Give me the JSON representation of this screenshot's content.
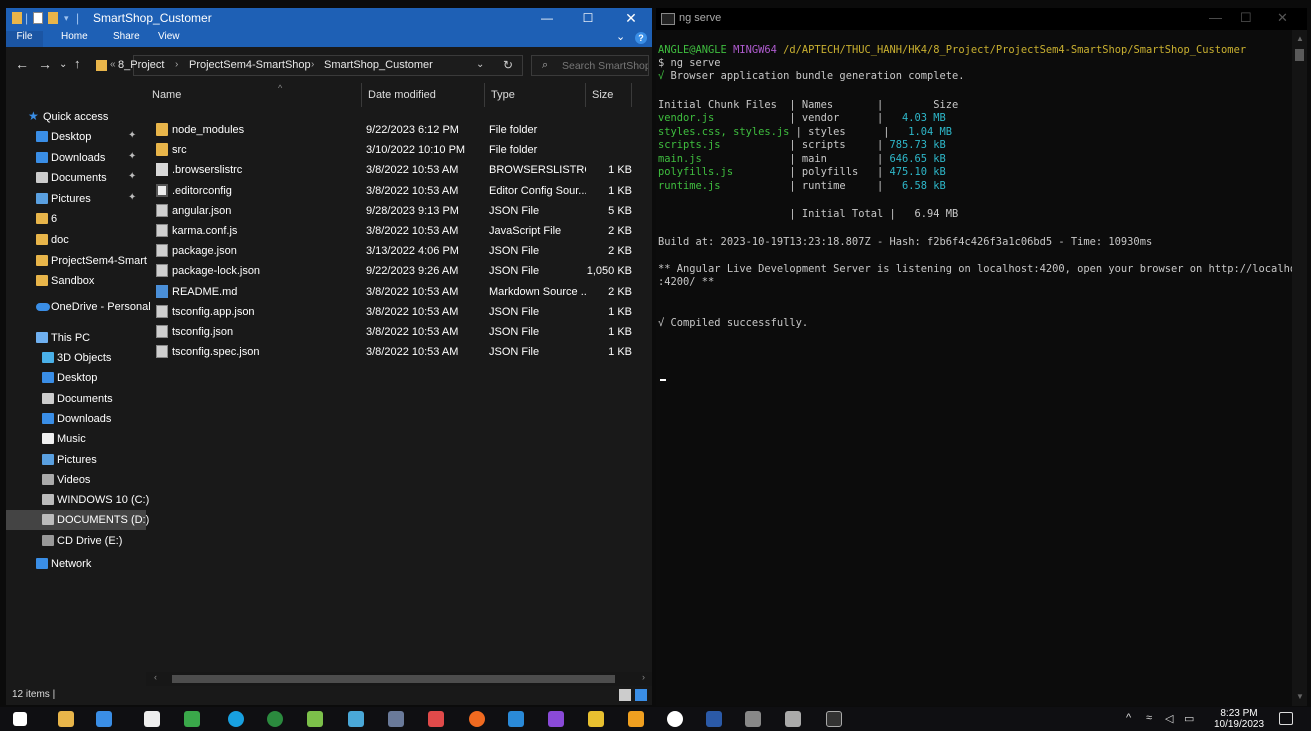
{
  "explorer": {
    "title": "SmartShop_Customer",
    "ribbon": {
      "file": "File",
      "home": "Home",
      "share": "Share",
      "view": "View"
    },
    "breadcrumb": [
      "8_Project",
      "ProjectSem4-SmartShop",
      "SmartShop_Customer"
    ],
    "search_placeholder": "Search SmartShop...",
    "columns": {
      "name": "Name",
      "date": "Date modified",
      "type": "Type",
      "size": "Size"
    },
    "quick_access_label": "Quick access",
    "nav": [
      {
        "label": "Desktop",
        "icon": "desktop-icon",
        "pinned": true
      },
      {
        "label": "Downloads",
        "icon": "download-icon",
        "pinned": true
      },
      {
        "label": "Documents",
        "icon": "documents-icon",
        "pinned": true
      },
      {
        "label": "Pictures",
        "icon": "pictures-icon",
        "pinned": true
      },
      {
        "label": "6",
        "icon": "folder-icon",
        "pinned": false
      },
      {
        "label": "doc",
        "icon": "folder-icon",
        "pinned": false
      },
      {
        "label": "ProjectSem4-Smart",
        "icon": "folder-icon",
        "pinned": false
      },
      {
        "label": "Sandbox",
        "icon": "folder-icon",
        "pinned": false
      }
    ],
    "onedrive_label": "OneDrive - Personal",
    "thispc_label": "This PC",
    "pc_items": [
      {
        "label": "3D Objects",
        "icon": "3d-objects-icon"
      },
      {
        "label": "Desktop",
        "icon": "desktop-icon"
      },
      {
        "label": "Documents",
        "icon": "documents-icon"
      },
      {
        "label": "Downloads",
        "icon": "download-icon"
      },
      {
        "label": "Music",
        "icon": "music-icon"
      },
      {
        "label": "Pictures",
        "icon": "pictures-icon"
      },
      {
        "label": "Videos",
        "icon": "videos-icon"
      },
      {
        "label": "WINDOWS 10 (C:)",
        "icon": "drive-icon"
      },
      {
        "label": "DOCUMENTS (D:)",
        "icon": "drive-icon"
      },
      {
        "label": "CD Drive (E:)",
        "icon": "cd-drive-icon"
      }
    ],
    "network_label": "Network",
    "files": [
      {
        "name": "node_modules",
        "date": "9/22/2023 6:12 PM",
        "type": "File folder",
        "size": "",
        "icon": "folder"
      },
      {
        "name": "src",
        "date": "3/10/2022 10:10 PM",
        "type": "File folder",
        "size": "",
        "icon": "folder"
      },
      {
        "name": ".browserslistrc",
        "date": "3/8/2022 10:53 AM",
        "type": "BROWSERSLISTRC...",
        "size": "1 KB",
        "icon": "doc"
      },
      {
        "name": ".editorconfig",
        "date": "3/8/2022 10:53 AM",
        "type": "Editor Config Sour...",
        "size": "1 KB",
        "icon": "ec"
      },
      {
        "name": "angular.json",
        "date": "9/28/2023 9:13 PM",
        "type": "JSON File",
        "size": "5 KB",
        "icon": "json"
      },
      {
        "name": "karma.conf.js",
        "date": "3/8/2022 10:53 AM",
        "type": "JavaScript File",
        "size": "2 KB",
        "icon": "json"
      },
      {
        "name": "package.json",
        "date": "3/13/2022 4:06 PM",
        "type": "JSON File",
        "size": "2 KB",
        "icon": "json"
      },
      {
        "name": "package-lock.json",
        "date": "9/22/2023 9:26 AM",
        "type": "JSON File",
        "size": "1,050 KB",
        "icon": "json"
      },
      {
        "name": "README.md",
        "date": "3/8/2022 10:53 AM",
        "type": "Markdown Source ...",
        "size": "2 KB",
        "icon": "md"
      },
      {
        "name": "tsconfig.app.json",
        "date": "3/8/2022 10:53 AM",
        "type": "JSON File",
        "size": "1 KB",
        "icon": "json"
      },
      {
        "name": "tsconfig.json",
        "date": "3/8/2022 10:53 AM",
        "type": "JSON File",
        "size": "1 KB",
        "icon": "json"
      },
      {
        "name": "tsconfig.spec.json",
        "date": "3/8/2022 10:53 AM",
        "type": "JSON File",
        "size": "1 KB",
        "icon": "json"
      }
    ],
    "status": "12 items"
  },
  "terminal": {
    "title": "ng serve",
    "prompt_user": "ANGLE@ANGLE",
    "prompt_host": "MINGW64",
    "prompt_path": "/d/APTECH/THUC_HANH/HK4/8_Project/ProjectSem4-SmartShop/SmartShop_Customer",
    "command": "$ ng serve",
    "bundle_msg": "Browser application bundle generation complete.",
    "table_header": {
      "files": "Initial Chunk Files",
      "names": "Names",
      "size": "Size"
    },
    "chunks": [
      {
        "file": "vendor.js",
        "name": "vendor",
        "size": "4.03 MB"
      },
      {
        "file": "styles.css, styles.js",
        "name": "styles",
        "size": "1.04 MB"
      },
      {
        "file": "scripts.js",
        "name": "scripts",
        "size": "785.73 kB"
      },
      {
        "file": "main.js",
        "name": "main",
        "size": "646.65 kB"
      },
      {
        "file": "polyfills.js",
        "name": "polyfills",
        "size": "475.10 kB"
      },
      {
        "file": "runtime.js",
        "name": "runtime",
        "size": "6.58 kB"
      }
    ],
    "total_label": "Initial Total",
    "total_size": "6.94 MB",
    "build_line": "Build at: 2023-10-19T13:23:18.807Z - Hash: f2b6f4c426f3a1c06bd5 - Time: 10930ms",
    "server_line1": "** Angular Live Development Server is listening on localhost:4200, open your browser on http://localhost",
    "server_line2": ":4200/ **",
    "compiled": "√ Compiled successfully."
  },
  "taskbar": {
    "time": "8:23 PM",
    "date": "10/19/2023"
  },
  "colors": {
    "title_blue": "#1e60b5",
    "term_green": "#3fbe3f",
    "term_cyan": "#2eb7c9"
  }
}
